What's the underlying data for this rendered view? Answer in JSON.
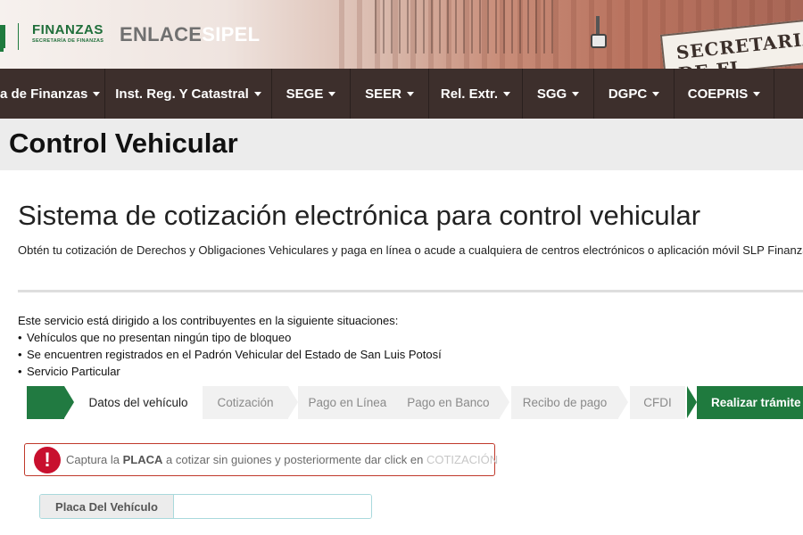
{
  "header": {
    "logo_text": "FINANZAS",
    "logo_sub": "SECRETARÍA DE FINANZAS",
    "brand_part1": "ENLACE",
    "brand_part2": "SIPEL",
    "building_sign": "SECRETARIA DE FI"
  },
  "nav": {
    "items": [
      {
        "label": "a de Finanzas"
      },
      {
        "label": "Inst. Reg. Y Catastral"
      },
      {
        "label": "SEGE"
      },
      {
        "label": "SEER"
      },
      {
        "label": "Rel. Extr."
      },
      {
        "label": "SGG"
      },
      {
        "label": "DGPC"
      },
      {
        "label": "COEPRIS"
      }
    ]
  },
  "page": {
    "title": "Control Vehicular",
    "heading": "Sistema de cotización electrónica para control vehicular",
    "description": "Obtén tu cotización de Derechos y Obligaciones Vehiculares y paga en línea o acude a cualquiera de centros electrónicos o aplicación móvil SLP Finanzas o v"
  },
  "info": {
    "intro": "Este servicio está dirigido a los contribuyentes en la siguiente situaciones:",
    "bullets": [
      "Vehículos que no presentan ningún tipo de bloqueo",
      "Se encuentren registrados en el Padrón Vehicular del Estado de San Luis Potosí",
      "Servicio Particular"
    ],
    "bullet_char": "•"
  },
  "steps": {
    "items": [
      {
        "label": "Datos del vehículo",
        "state": "active"
      },
      {
        "label": "Cotización",
        "state": "pending"
      },
      {
        "label": "Pago en Línea",
        "state": "pending"
      },
      {
        "label": "Pago en Banco",
        "state": "pending"
      },
      {
        "label": "Recibo de pago",
        "state": "pending"
      },
      {
        "label": "CFDI",
        "state": "pending"
      },
      {
        "label": "Realizar trámite en",
        "state": "final"
      }
    ],
    "colors": {
      "active": "#217a41",
      "pending_bg": "#f1f1f1",
      "pending_text": "#8a8a8a",
      "final_bg": "#1f7a3e"
    }
  },
  "alert": {
    "icon": "!",
    "text_before": "Captura la",
    "emphasis": "PLACA",
    "text_middle": "a cotizar sin guiones y posteriormente dar click en",
    "link_text": "COTIZACIÓN",
    "color": "#c8102e"
  },
  "form": {
    "plate_label": "Placa Del Vehículo",
    "plate_value": "",
    "plate_placeholder": ""
  }
}
